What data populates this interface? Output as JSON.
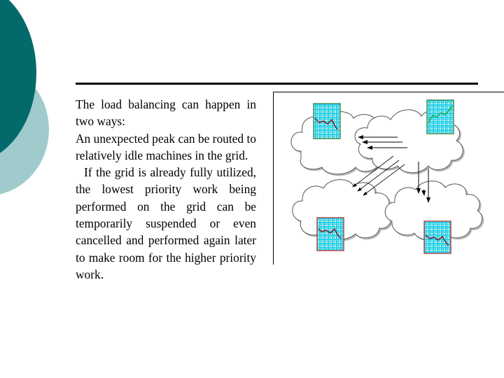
{
  "slide": {
    "body_paragraphs": [
      "The load balancing can happen in two ways:",
      "An unexpected peak can be routed to relatively idle machines in the grid.",
      "If the grid is already fully utilized, the lowest priority work being performed on the grid can be temporarily suspended or even cancelled and performed again later to make room for the higher priority work."
    ],
    "theme_colors": {
      "dark_teal": "#04696a",
      "light_teal": "#9fcbcc",
      "chart_cyan": "#22d3f0",
      "chart_cream": "#f4ecd8"
    }
  },
  "diagram": {
    "description": "Four grid clouds; the busy cloud (top-right, rising chart) offloads work via arrows to the idle clouds (top-left, bottom-left, bottom-right, falling charts)",
    "clouds": [
      {
        "id": "top-left",
        "load_trend": "falling",
        "chart_border": "#3f8f5a"
      },
      {
        "id": "top-right",
        "load_trend": "rising",
        "chart_border": "#3f8f5a"
      },
      {
        "id": "bottom-left",
        "load_trend": "falling",
        "chart_border": "#b04a4a"
      },
      {
        "id": "bottom-right",
        "load_trend": "falling",
        "chart_border": "#b04a4a"
      }
    ],
    "arrow_groups": [
      {
        "from": "top-right",
        "to": "top-left",
        "count": 3
      },
      {
        "from": "top-right",
        "to": "bottom-left",
        "count": 3
      },
      {
        "from": "top-right",
        "to": "bottom-right",
        "count": 2
      }
    ]
  }
}
